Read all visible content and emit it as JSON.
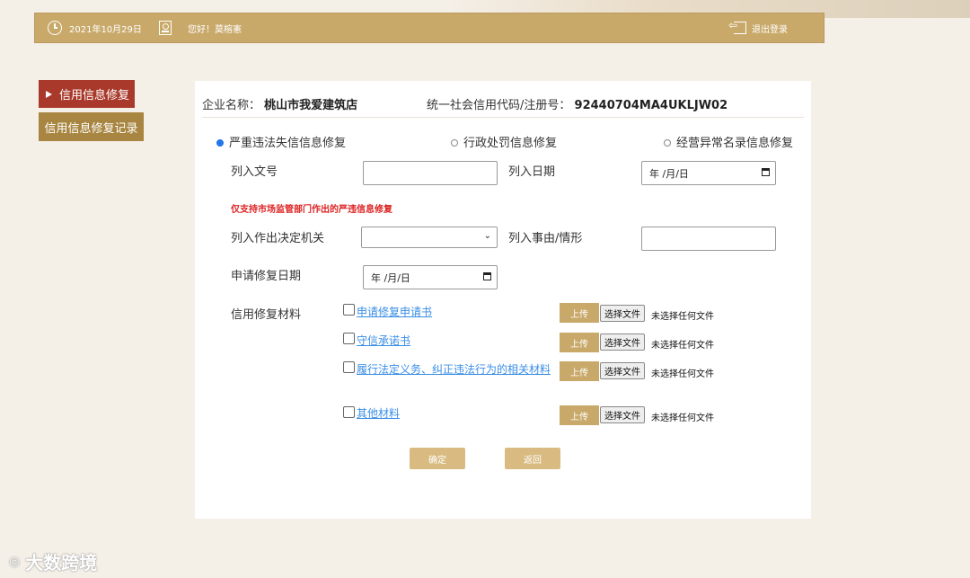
{
  "topbar": {
    "date": "2021年10月29日",
    "greeting": "您好！莫榕憲",
    "logout": "退出登录",
    "clock_icon": "clock-icon",
    "user_icon": "user-card-icon",
    "logout_icon": "logout-icon"
  },
  "sidebar": {
    "items": [
      {
        "label": "信用信息修复",
        "active": true
      },
      {
        "label": "信用信息修复记录",
        "active": false
      }
    ]
  },
  "header": {
    "company_label": "企业名称：",
    "company_name": "桃山市我爱建筑店",
    "code_label": "统一社会信用代码/注册号：",
    "code_value": "92440704MA4UKLJW02"
  },
  "repair_types": [
    {
      "label": "严重违法失信信息修复",
      "selected": true
    },
    {
      "label": "行政处罚信息修复",
      "selected": false
    },
    {
      "label": "经营异常名录信息修复",
      "selected": false
    }
  ],
  "form": {
    "doc_no_label": "列入文号",
    "doc_no_value": "",
    "list_date_label": "列入日期",
    "list_date_placeholder": "年 /月/日",
    "notice": "仅支持市场监管部门作出的严违信息修复",
    "authority_label": "列入作出决定机关",
    "authority_value": "",
    "reason_label": "列入事由/情形",
    "reason_value": "",
    "apply_date_label": "申请修复日期",
    "apply_date_placeholder": "年 /月/日",
    "materials_label": "信用修复材料"
  },
  "materials": [
    {
      "name": "申请修复申请书"
    },
    {
      "name": "守信承诺书"
    },
    {
      "name": "履行法定义务、纠正违法行为的相关材料"
    },
    {
      "name": "其他材料"
    }
  ],
  "upload": {
    "upload_label": "上传",
    "choose_label": "选择文件",
    "no_file": "未选择任何文件"
  },
  "actions": {
    "confirm": "确定",
    "back": "返回"
  },
  "watermark": "大数跨境",
  "colors": {
    "gold": "#c9a96a",
    "red": "#a93a2b",
    "link": "#3a8ee6",
    "warn": "#dd2222"
  }
}
